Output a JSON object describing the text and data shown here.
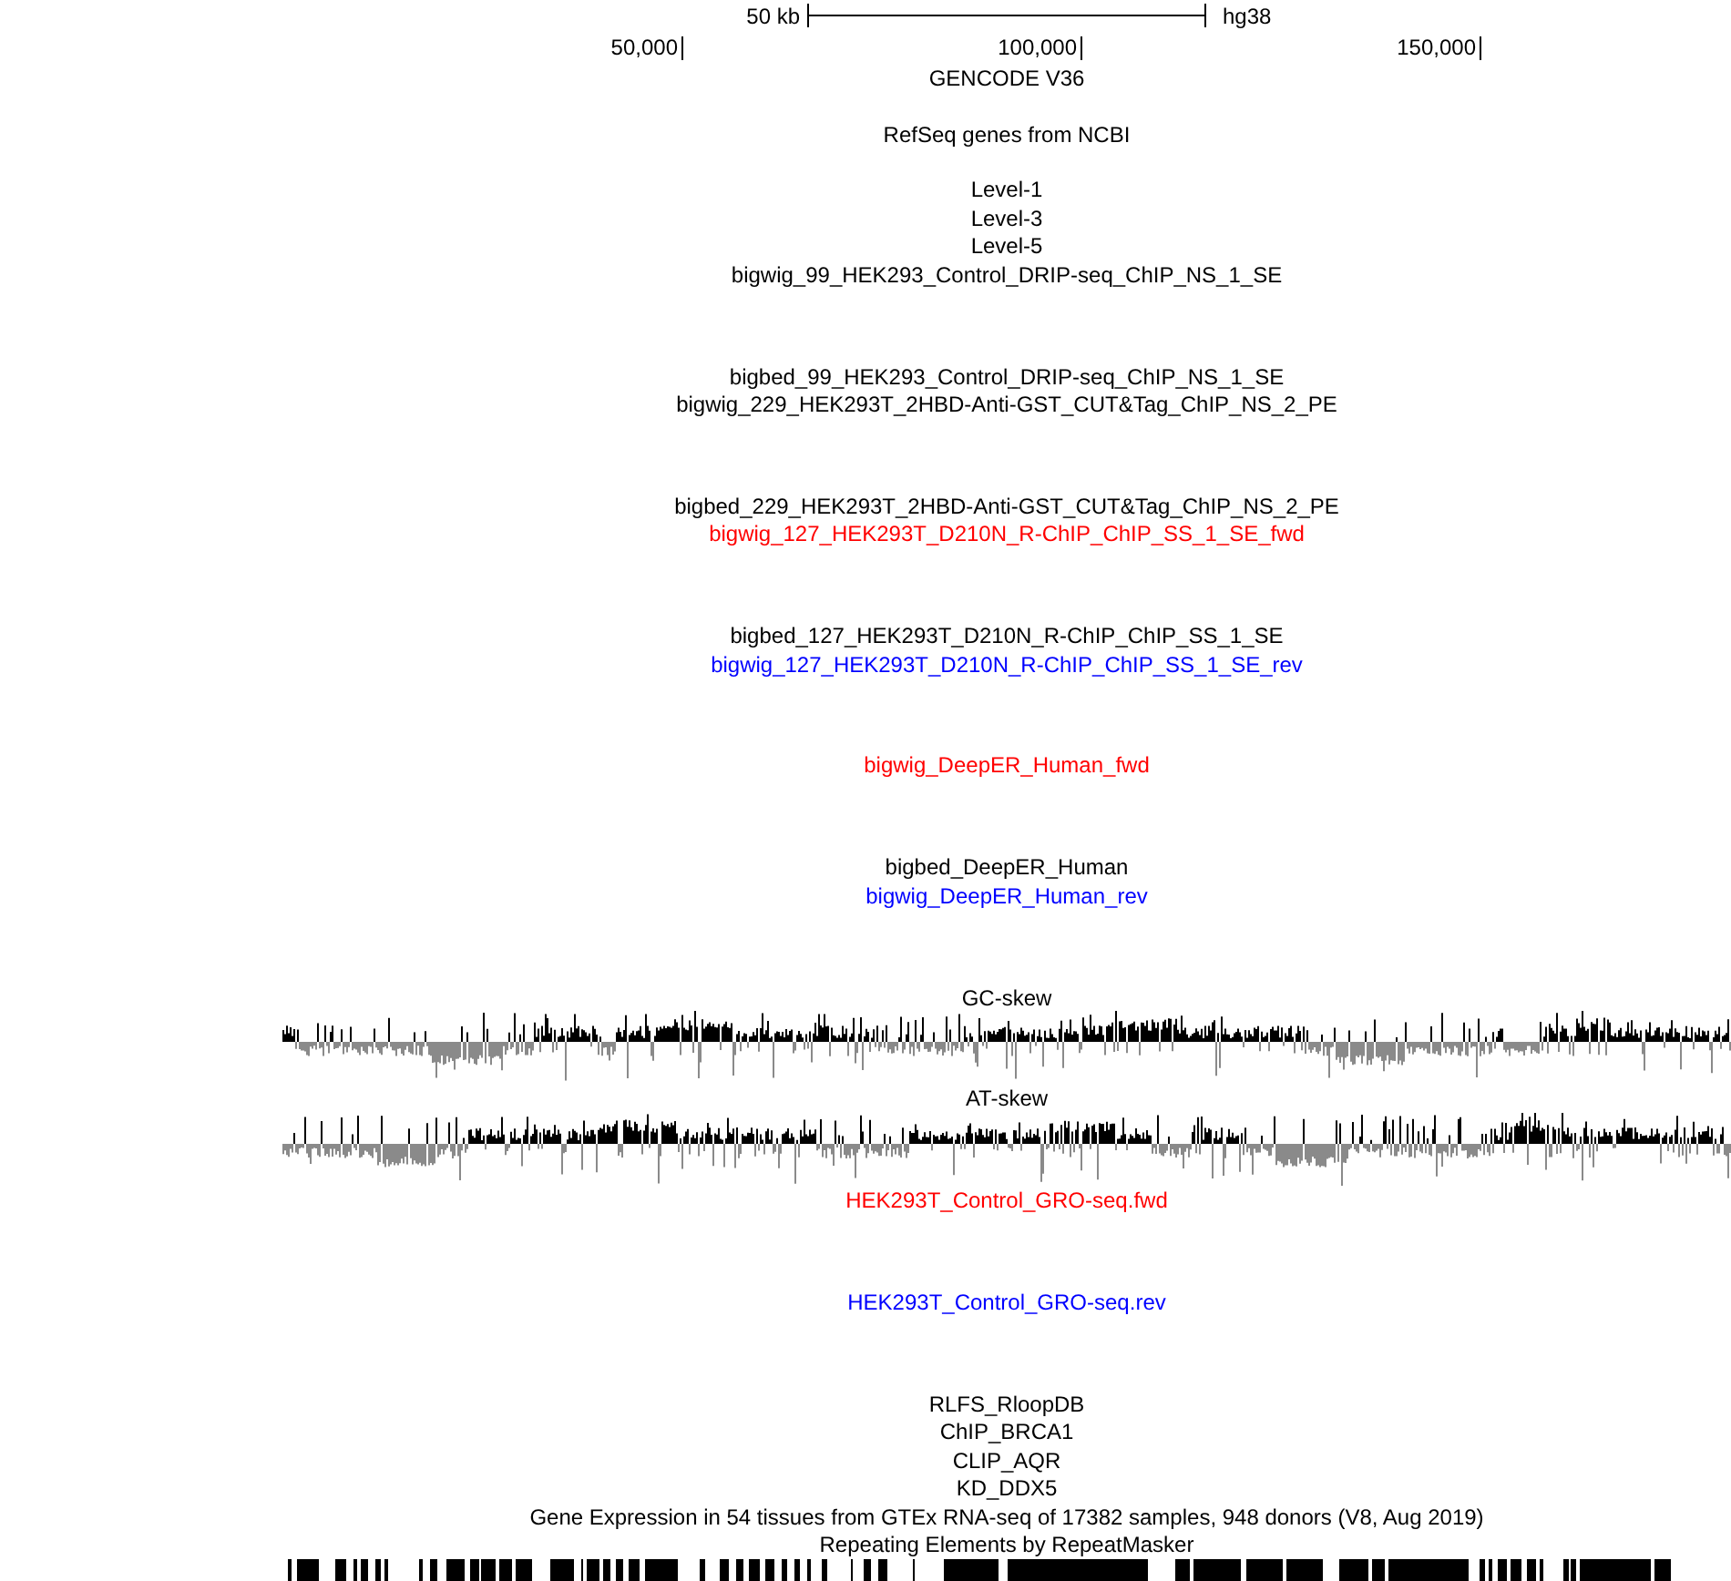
{
  "scale_bar": {
    "length": "50 kb",
    "assembly": "hg38"
  },
  "ruler": {
    "ticks": [
      "50,000",
      "100,000",
      "150,000"
    ]
  },
  "tracks": [
    {
      "label": "GENCODE V36",
      "kind": "gene",
      "color": "#000000"
    },
    {
      "label": "RefSeq genes from NCBI",
      "kind": "gene",
      "color": "#000000"
    },
    {
      "label": "Level-1",
      "kind": "feature",
      "color": "#000000"
    },
    {
      "label": "Level-3",
      "kind": "feature",
      "color": "#000000"
    },
    {
      "label": "Level-5",
      "kind": "feature",
      "color": "#000000"
    },
    {
      "label": "bigwig_99_HEK293_Control_DRIP-seq_ChIP_NS_1_SE",
      "kind": "signal",
      "color": "#000000"
    },
    {
      "label": "bigbed_99_HEK293_Control_DRIP-seq_ChIP_NS_1_SE",
      "kind": "feature",
      "color": "#000000"
    },
    {
      "label": "bigwig_229_HEK293T_2HBD-Anti-GST_CUT&Tag_ChIP_NS_2_PE",
      "kind": "signal",
      "color": "#000000"
    },
    {
      "label": "bigbed_229_HEK293T_2HBD-Anti-GST_CUT&Tag_ChIP_NS_2_PE",
      "kind": "feature",
      "color": "#000000"
    },
    {
      "label": "bigwig_127_HEK293T_D210N_R-ChIP_ChIP_SS_1_SE_fwd",
      "kind": "signal",
      "color": "#ff0000"
    },
    {
      "label": "bigbed_127_HEK293T_D210N_R-ChIP_ChIP_SS_1_SE",
      "kind": "feature",
      "color": "#000000"
    },
    {
      "label": "bigwig_127_HEK293T_D210N_R-ChIP_ChIP_SS_1_SE_rev",
      "kind": "signal",
      "color": "#0000ff"
    },
    {
      "label": "bigwig_DeepER_Human_fwd",
      "kind": "signal",
      "color": "#ff0000"
    },
    {
      "label": "bigbed_DeepER_Human",
      "kind": "feature",
      "color": "#000000"
    },
    {
      "label": "bigwig_DeepER_Human_rev",
      "kind": "signal",
      "color": "#0000ff"
    },
    {
      "label": "GC-skew",
      "kind": "skew",
      "color": "#000000"
    },
    {
      "label": "AT-skew",
      "kind": "skew",
      "color": "#000000"
    },
    {
      "label": "HEK293T_Control_GRO-seq.fwd",
      "kind": "signal",
      "color": "#ff0000"
    },
    {
      "label": "HEK293T_Control_GRO-seq.rev",
      "kind": "signal",
      "color": "#0000ff"
    },
    {
      "label": "RLFS_RloopDB",
      "kind": "feature",
      "color": "#000000"
    },
    {
      "label": "ChIP_BRCA1",
      "kind": "feature",
      "color": "#000000"
    },
    {
      "label": "CLIP_AQR",
      "kind": "feature",
      "color": "#000000"
    },
    {
      "label": "KD_DDX5",
      "kind": "feature",
      "color": "#000000"
    },
    {
      "label": "Gene Expression in 54 tissues from GTEx RNA-seq of 17382 samples, 948 donors (V8, Aug 2019)",
      "kind": "feature",
      "color": "#000000"
    },
    {
      "label": "Repeating Elements by RepeatMasker",
      "kind": "repeat",
      "color": "#000000"
    }
  ]
}
